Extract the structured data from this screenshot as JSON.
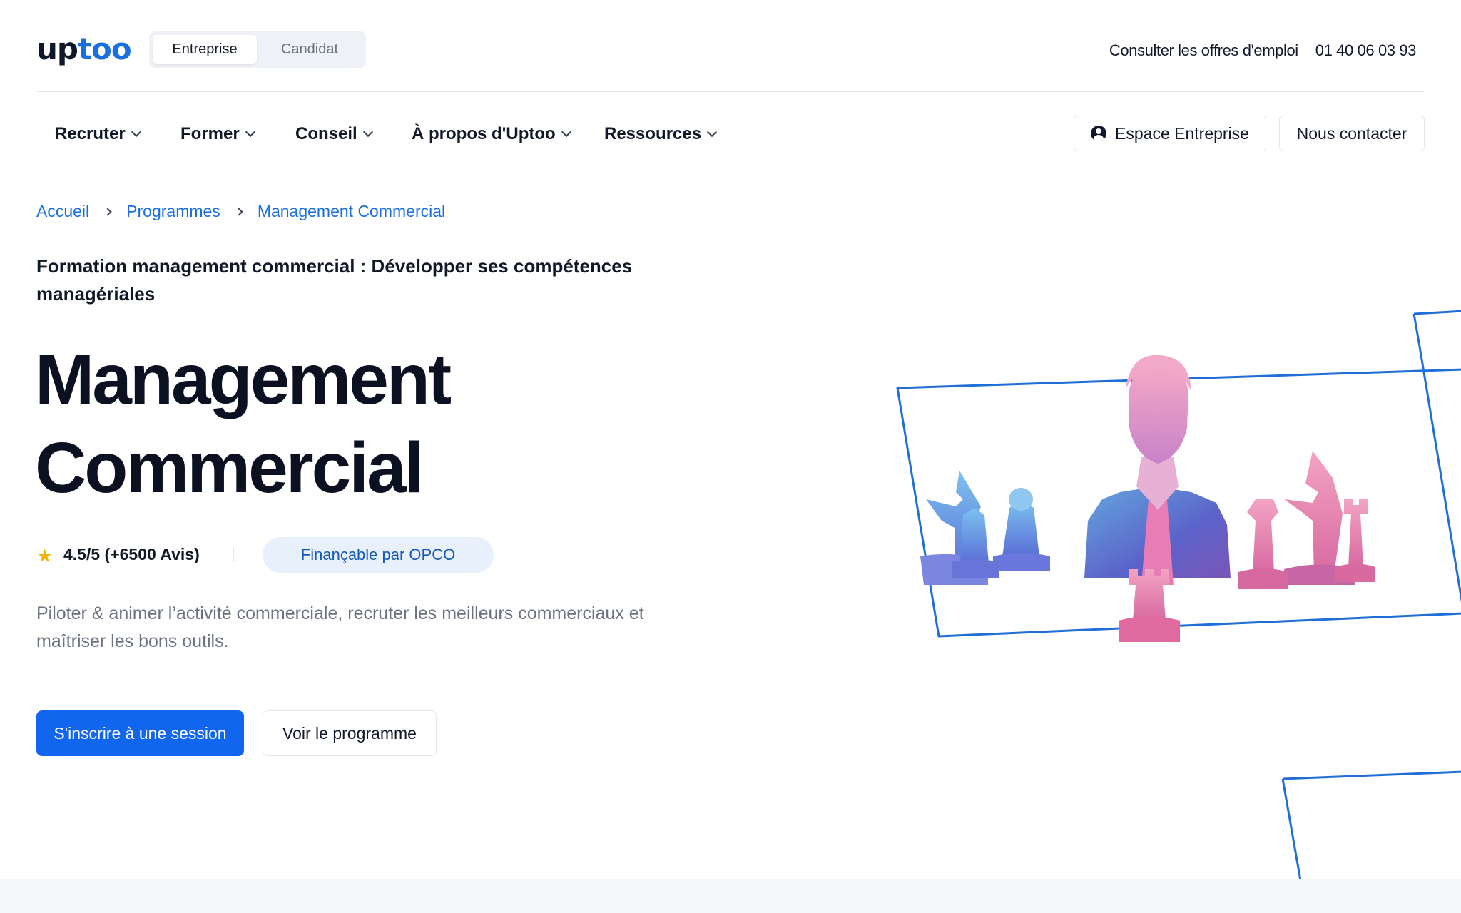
{
  "header": {
    "logo_part1": "up",
    "logo_part2": "too",
    "switch": {
      "active": "Entreprise",
      "inactive": "Candidat"
    },
    "offers_link": "Consulter les offres d'emploi",
    "phone": "01 40 06 03 93"
  },
  "nav": {
    "items": [
      {
        "label": "Recruter"
      },
      {
        "label": "Former"
      },
      {
        "label": "Conseil"
      },
      {
        "label": "À propos d'Uptoo"
      },
      {
        "label": "Ressources"
      }
    ],
    "espace_label": "Espace Entreprise",
    "contact_label": "Nous contacter"
  },
  "breadcrumb": [
    "Accueil",
    "Programmes",
    "Management Commercial"
  ],
  "hero": {
    "subtitle": "Formation management commercial : Développer ses compétences managériales",
    "title_line1": "Management",
    "title_line2": "Commercial",
    "rating": "4.5/5 (+6500 Avis)",
    "badge": "Finançable par OPCO",
    "description": "Piloter & animer l’activité commerciale, recruter les meilleurs commerciaux et maîtriser les bons outils.",
    "cta_primary": "S'inscrire à une session",
    "cta_secondary": "Voir le programme"
  },
  "colors": {
    "brand_blue": "#1166f0",
    "link_blue": "#1a6fe0",
    "badge_bg": "#e8f0fb",
    "star": "#f5b301"
  },
  "icons": {
    "star": "star-icon",
    "user": "user-circle-icon",
    "chevron": "chevron-down-icon",
    "breadcrumb_sep": "chevron-right-icon"
  }
}
